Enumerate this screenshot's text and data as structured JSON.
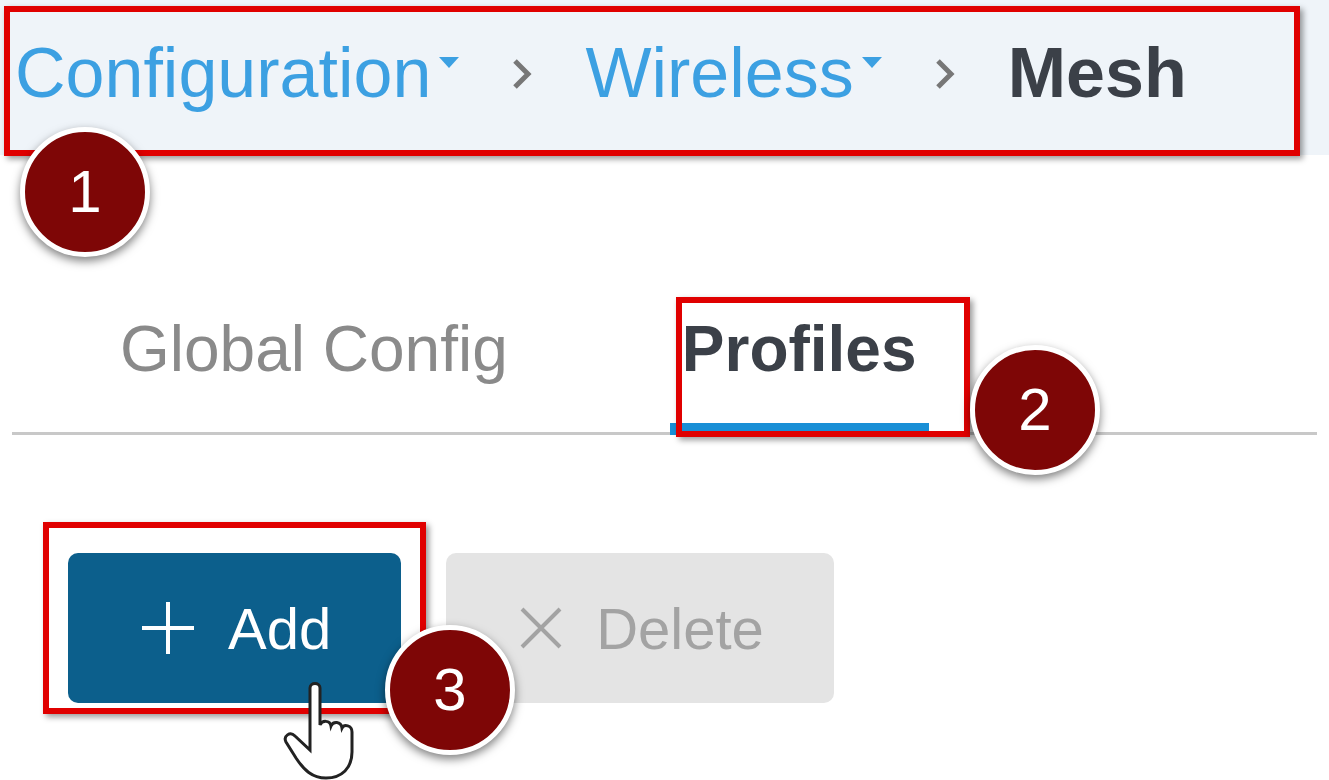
{
  "breadcrumb": [
    {
      "label": "Configuration",
      "dropdown": true,
      "current": false
    },
    {
      "label": "Wireless",
      "dropdown": true,
      "current": false
    },
    {
      "label": "Mesh",
      "dropdown": false,
      "current": true
    }
  ],
  "tabs": [
    {
      "label": "Global Config",
      "selected": false
    },
    {
      "label": "Profiles",
      "selected": true
    }
  ],
  "buttons": [
    {
      "label": "Add",
      "kind": "add",
      "disabled": false
    },
    {
      "label": "Delete",
      "kind": "delete",
      "disabled": true
    }
  ],
  "callouts": [
    "1",
    "2",
    "3"
  ]
}
